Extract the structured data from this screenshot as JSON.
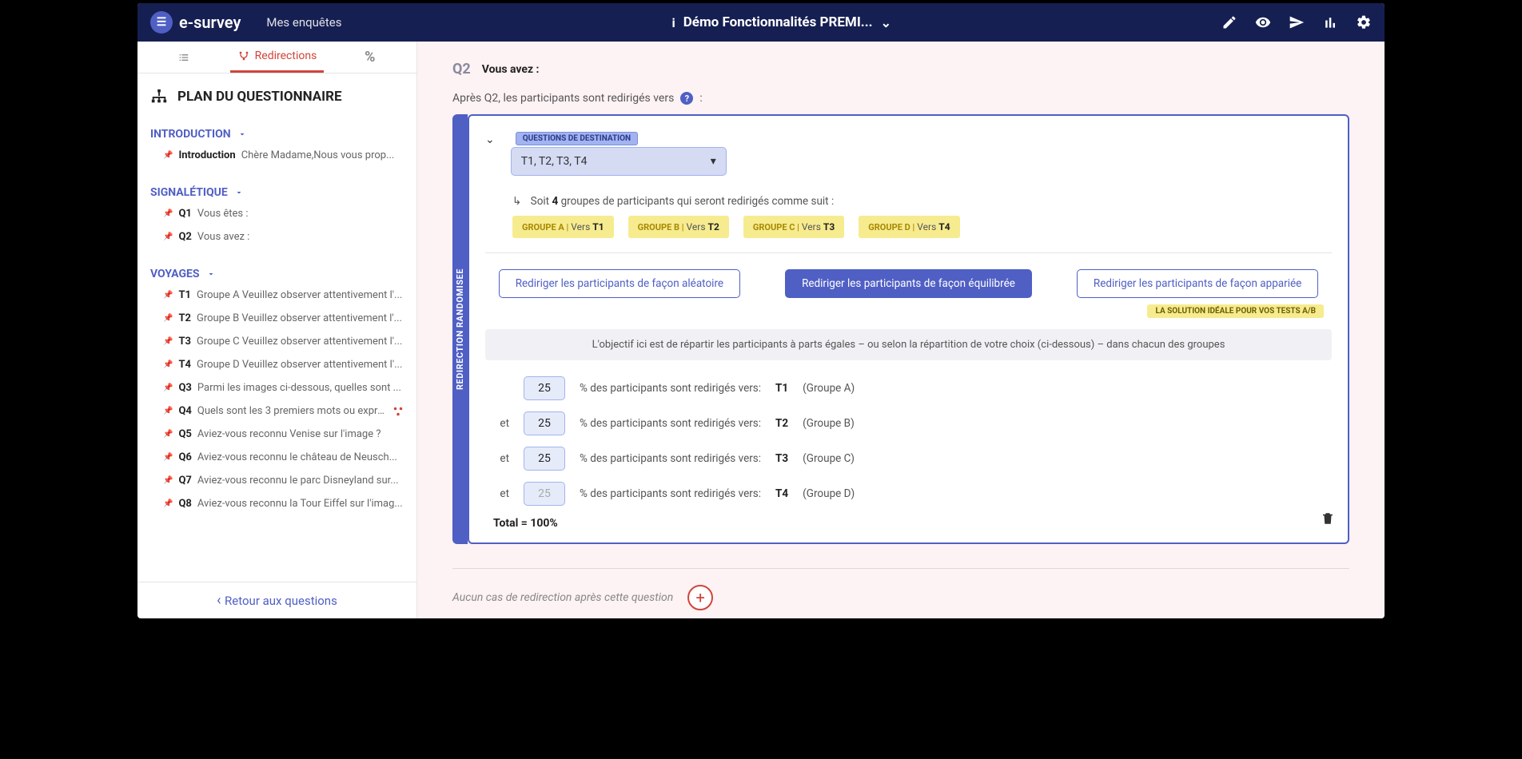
{
  "topbar": {
    "brand": "e-survey",
    "nav_surveys": "Mes enquêtes",
    "survey_title": "Démo Fonctionnalités PREMI..."
  },
  "sidebar": {
    "tabs": {
      "redirections": "Redirections"
    },
    "plan_title": "PLAN DU QUESTIONNAIRE",
    "sections": [
      {
        "title": "INTRODUCTION",
        "items": [
          {
            "code": "Introduction",
            "text": "Chère Madame,Nous vous prop..."
          }
        ]
      },
      {
        "title": "SIGNALÉTIQUE",
        "items": [
          {
            "code": "Q1",
            "text": "Vous êtes :"
          },
          {
            "code": "Q2",
            "text": "Vous avez :"
          }
        ]
      },
      {
        "title": "VOYAGES",
        "items": [
          {
            "code": "T1",
            "text": "Groupe A Veuillez observer attentivement l'..."
          },
          {
            "code": "T2",
            "text": "Groupe B Veuillez observer attentivement l'..."
          },
          {
            "code": "T3",
            "text": "Groupe C Veuillez observer attentivement l'..."
          },
          {
            "code": "T4",
            "text": "Groupe D Veuillez observer attentivement l'..."
          },
          {
            "code": "Q3",
            "text": "Parmi les images ci-dessous, quelles sont ..."
          },
          {
            "code": "Q4",
            "text": "Quels sont les 3 premiers mots ou expre...",
            "has_redir": true
          },
          {
            "code": "Q5",
            "text": "Aviez-vous reconnu Venise sur l'image ?"
          },
          {
            "code": "Q6",
            "text": "Aviez-vous reconnu le château de Neusch..."
          },
          {
            "code": "Q7",
            "text": "Aviez-vous reconnu le parc Disneyland sur..."
          },
          {
            "code": "Q8",
            "text": "Aviez-vous reconnu la Tour Eiffel sur l'imag..."
          }
        ]
      }
    ],
    "back": "Retour aux questions"
  },
  "main": {
    "q_code": "Q2",
    "q_title": "Vous avez :",
    "redirect_intro": "Après Q2, les participants sont redirigés vers",
    "colon": ":",
    "vlabel": "REDIRECTION RANDOMISEE",
    "dest_label": "QUESTIONS DE DESTINATION",
    "dest_value": "T1, T2, T3, T4",
    "group_line_pre": "Soit",
    "group_count": "4",
    "group_line_post": "groupes de participants qui seront redirigés comme suit :",
    "groups": [
      {
        "name": "GROUPE A |",
        "vers": "Vers",
        "target": "T1"
      },
      {
        "name": "GROUPE B |",
        "vers": "Vers",
        "target": "T2"
      },
      {
        "name": "GROUPE C |",
        "vers": "Vers",
        "target": "T3"
      },
      {
        "name": "GROUPE D |",
        "vers": "Vers",
        "target": "T4"
      }
    ],
    "modes": {
      "random": "Rediriger les participants de façon aléatoire",
      "balanced": "Rediriger les participants de façon équilibrée",
      "paired": "Rediriger les participants de façon appariée",
      "paired_tag": "LA SOLUTION IDÉALE POUR VOS TESTS A/B"
    },
    "info": "L'objectif ici est de répartir les participants à parts égales – ou selon la répartition de votre choix (ci-dessous) – dans chacun des groupes",
    "et": "et",
    "pct_suffix": "% des participants sont redirigés vers:",
    "rows": [
      {
        "value": "25",
        "target": "T1",
        "group": "(Groupe A)",
        "first": true
      },
      {
        "value": "25",
        "target": "T2",
        "group": "(Groupe B)"
      },
      {
        "value": "25",
        "target": "T3",
        "group": "(Groupe C)"
      },
      {
        "value": "25",
        "target": "T4",
        "group": "(Groupe D)",
        "disabled": true
      }
    ],
    "total": "Total = 100%",
    "add_text": "Aucun cas de redirection après cette question"
  }
}
